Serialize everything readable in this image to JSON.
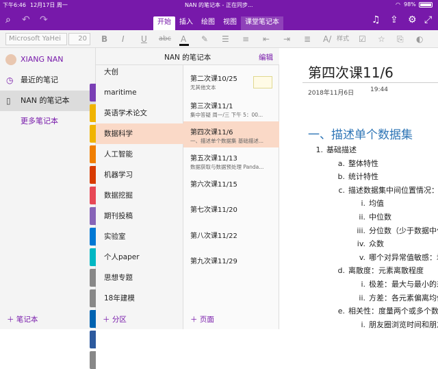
{
  "status": {
    "time": "下午6:46",
    "date": "12月17日 周一",
    "battery": "98%"
  },
  "window": {
    "title": "NAN 的笔记本 - 正在同步..."
  },
  "ribbon": {
    "tabs": [
      "开始",
      "插入",
      "绘图",
      "视图",
      "课堂笔记本"
    ]
  },
  "toolbar": {
    "font_name": "Microsoft YaHei",
    "font_size": "20",
    "style_label": "样式"
  },
  "nav": {
    "user": "XIANG NAN",
    "recent": "最近的笔记",
    "notebook": "NAN 的笔记本",
    "more": "更多笔记本",
    "add": "笔记本"
  },
  "pane": {
    "title": "NAN 的笔记本",
    "edit": "编辑",
    "add_section": "分区",
    "add_page": "页面"
  },
  "sections": [
    "大创",
    "maritime",
    "英语学术论文",
    "数据科学",
    "人工智能",
    "机器学习",
    "数据挖掘",
    "期刊投稿",
    "实验室",
    "个人paper",
    "思想专题",
    "18年建模"
  ],
  "section_colors": [
    "#7a3fb5",
    "#f0b400",
    "#f0b400",
    "#f07e00",
    "#d83b01",
    "#e74856",
    "#8764b8",
    "#0078d4",
    "#00b7c3",
    "#888888",
    "#888888",
    "#0063b1",
    "#2d5a9e",
    "#888888"
  ],
  "pages": [
    {
      "title": "第二次课10/25",
      "snippet": "无其他文本"
    },
    {
      "title": "第三次课11/1",
      "snippet": "集中答疑 周一/三 下午 5：00..."
    },
    {
      "title": "第四次课11/6",
      "snippet": "一、描述单个数据集 基础描述..."
    },
    {
      "title": "第五次课11/13",
      "snippet": "数据获取与数据预处理 Panda..."
    },
    {
      "title": "第六次课11/15",
      "snippet": ""
    },
    {
      "title": "第七次课11/20",
      "snippet": ""
    },
    {
      "title": "第八次课11/22",
      "snippet": ""
    },
    {
      "title": "第九次课11/29",
      "snippet": ""
    }
  ],
  "note": {
    "title": "第四次课11/6",
    "date": "2018年11月6日",
    "time": "19:44",
    "heading": "一、描述单个数据集",
    "lines": [
      {
        "n": "1.",
        "text": "基础描述"
      },
      {
        "n": "a.",
        "text": "整体特性"
      },
      {
        "n": "b.",
        "text": "统计特性"
      },
      {
        "n": "c.",
        "text": "描述数据集中间位置情况："
      },
      {
        "n": "i.",
        "text": "均值"
      },
      {
        "n": "ii.",
        "text": "中位数"
      },
      {
        "n": "iii.",
        "text": "分位数（少于数据中位"
      },
      {
        "n": "iv.",
        "text": "众数"
      },
      {
        "n": "v.",
        "text": "哪个对异常值敏感：均"
      },
      {
        "n": "d.",
        "text": "离散度：元素离散程度"
      },
      {
        "n": "i.",
        "text": "极差：最大与最小的差"
      },
      {
        "n": "ii.",
        "text": "方差：各元素偏离均值"
      },
      {
        "n": "e.",
        "text": "相关性：度量两个或多个数"
      },
      {
        "n": "i.",
        "text": "朋友圈浏览时间和朋友"
      }
    ]
  },
  "colors": {
    "accent": "#7719aa",
    "selected_section": "#fad9c7",
    "selected_nav": "#dcdcdc",
    "heading": "#2e75b6"
  }
}
